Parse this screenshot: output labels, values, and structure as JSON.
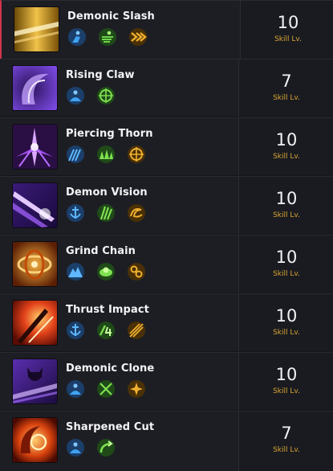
{
  "skills": [
    {
      "name": "Demonic Slash",
      "level": "10",
      "level_label": "Skill Lv.",
      "icon": "demonic-slash-icon",
      "tripods": [
        "blue-figure-icon",
        "green-dash-icon",
        "orange-chevrons-icon"
      ]
    },
    {
      "name": "Rising Claw",
      "level": "7",
      "level_label": "Skill Lv.",
      "icon": "rising-claw-icon",
      "tripods": [
        "blue-figure-icon",
        "green-target-icon"
      ]
    },
    {
      "name": "Piercing Thorn",
      "level": "10",
      "level_label": "Skill Lv.",
      "icon": "piercing-thorn-icon",
      "tripods": [
        "blue-spikes-icon",
        "green-spikes-icon",
        "orange-target-icon"
      ]
    },
    {
      "name": "Demon Vision",
      "level": "10",
      "level_label": "Skill Lv.",
      "icon": "demon-vision-icon",
      "tripods": [
        "blue-anchor-icon",
        "green-claw-icon",
        "orange-swirl-icon"
      ]
    },
    {
      "name": "Grind Chain",
      "level": "10",
      "level_label": "Skill Lv.",
      "icon": "grind-chain-icon",
      "tripods": [
        "blue-mountain-icon",
        "green-orb-icon",
        "orange-chain-icon"
      ]
    },
    {
      "name": "Thrust Impact",
      "level": "10",
      "level_label": "Skill Lv.",
      "icon": "thrust-impact-icon",
      "tripods": [
        "blue-anchor-icon",
        "green-number-icon",
        "orange-spark-icon"
      ]
    },
    {
      "name": "Demonic Clone",
      "level": "10",
      "level_label": "Skill Lv.",
      "icon": "demonic-clone-icon",
      "tripods": [
        "blue-figure-icon",
        "green-cross-icon",
        "orange-gear-icon"
      ]
    },
    {
      "name": "Sharpened Cut",
      "level": "7",
      "level_label": "Skill Lv.",
      "icon": "sharpened-cut-icon",
      "tripods": [
        "blue-figure-icon",
        "green-curve-icon"
      ]
    }
  ],
  "colors": {
    "tripod_blue": "#2f86d8",
    "tripod_green": "#49b534",
    "tripod_orange": "#d99a22",
    "level_label": "#d9a531",
    "selected_accent": "#d0344a"
  }
}
